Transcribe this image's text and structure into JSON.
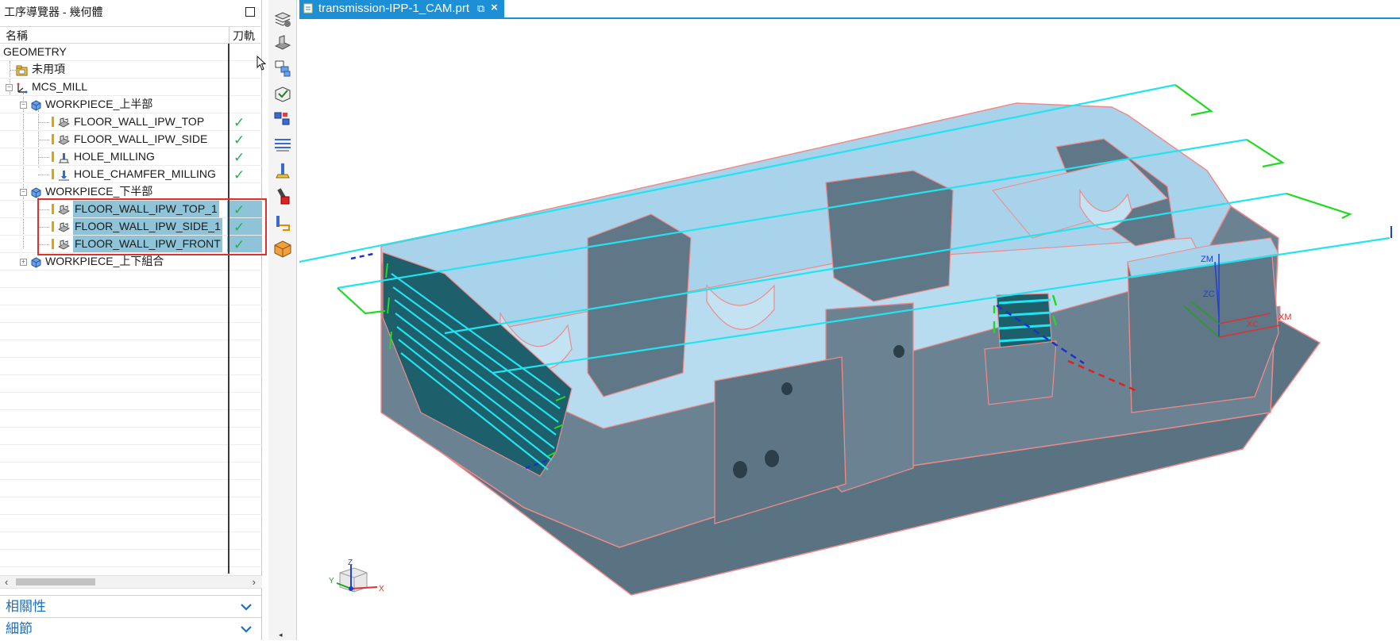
{
  "navigator": {
    "title": "工序導覽器 - 幾何體",
    "columns": {
      "name": "名稱",
      "toolpath": "刀軌"
    },
    "rows": [
      {
        "label": "GEOMETRY",
        "level": 0
      },
      {
        "label": "未用項",
        "level": 1
      },
      {
        "label": "MCS_MILL",
        "level": 1
      },
      {
        "label": "WORKPIECE_上半部",
        "level": 2
      },
      {
        "label": "FLOOR_WALL_IPW_TOP",
        "level": 3,
        "status": "✓"
      },
      {
        "label": "FLOOR_WALL_IPW_SIDE",
        "level": 3,
        "status": "✓"
      },
      {
        "label": "HOLE_MILLING",
        "level": 3,
        "status": "✓"
      },
      {
        "label": "HOLE_CHAMFER_MILLING",
        "level": 3,
        "status": "✓"
      },
      {
        "label": "WORKPIECE_下半部",
        "level": 2
      },
      {
        "label": "FLOOR_WALL_IPW_TOP_1",
        "level": 3,
        "status": "✓",
        "selected": true
      },
      {
        "label": "FLOOR_WALL_IPW_SIDE_1",
        "level": 3,
        "status": "✓",
        "selected": true
      },
      {
        "label": "FLOOR_WALL_IPW_FRONT",
        "level": 3,
        "status": "✓",
        "selected": true
      },
      {
        "label": "WORKPIECE_上下組合",
        "level": 2
      }
    ],
    "sections": {
      "dependencies": "相關性",
      "details": "細節"
    }
  },
  "document_tab": {
    "label": "transmission-IPP-1_CAM.prt",
    "close": "×"
  },
  "viewport": {
    "axis_labels": {
      "zm": "ZM",
      "zc": "ZC",
      "xc": "XC",
      "xm": "XM"
    },
    "triad_labels": {
      "z": "Z",
      "y": "Y",
      "x": "X"
    }
  },
  "colors": {
    "accent": "#1d8fd6",
    "selection": "#8fc4d8",
    "check": "#22b14c",
    "highlight_box": "#e0302c",
    "part_light": "#a9d3ea",
    "part_dark": "#5d7585",
    "edge": "#f08a8a",
    "toolpath": "#22e4f0",
    "toolpath_transition": "#22d922"
  },
  "icons": {
    "maximize": "maximize-icon",
    "program_view": "program-order-view-icon",
    "machine_tool": "machine-tool-view-icon",
    "geometry_view": "geometry-view-icon",
    "method_view": "machining-method-view-icon"
  }
}
